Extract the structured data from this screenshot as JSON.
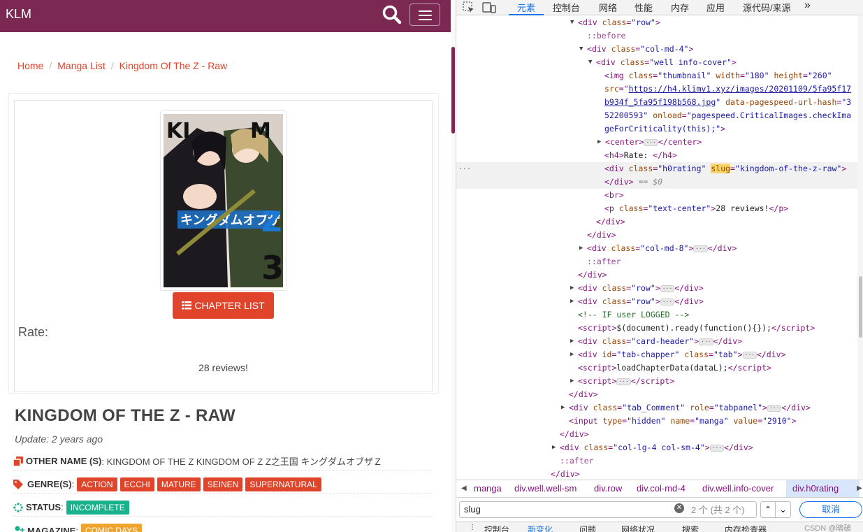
{
  "site": {
    "brand": "KLM",
    "breadcrumb": {
      "home": "Home",
      "list": "Manga List",
      "current": "Kingdom Of The Z - Raw",
      "sep": "/"
    },
    "chapter_button": "CHAPTER LIST",
    "rate_label": "Rate:",
    "reviews": "28 reviews!",
    "title": "KINGDOM OF THE Z - RAW",
    "update": "Update: 2 years ago",
    "other_name_label": "OTHER NAME (S)",
    "other_name_value": ": KINGDOM OF THE Z KINGDOM OF Z Z之王国 キングダムオブザＺ",
    "genre_label": "GENRE(S)",
    "genres": [
      "ACTION",
      "ECCHI",
      "MATURE",
      "SEINEN",
      "SUPERNATURAL"
    ],
    "status_label": "STATUS",
    "status_value": "INCOMPLETE",
    "magazine_label": "MAGAZINE",
    "magazine_value": "COMIC DAYS",
    "colon": ":",
    "accent_color": "#e0442b",
    "nav_color": "#7b2853"
  },
  "devtools": {
    "tabs": [
      "元素",
      "控制台",
      "网络",
      "性能",
      "内存",
      "应用",
      "源代码/来源"
    ],
    "more": "»",
    "code": {
      "l1_tag": "div",
      "l1_attr": "class",
      "l1_val": "\"row\"",
      "before": "::before",
      "l3_tag": "div",
      "l3_val": "\"col-md-4\"",
      "l4_tag": "div",
      "l4_val": "\"well info-cover\"",
      "img_tag": "img",
      "img_class": "\"thumbnail\"",
      "img_w_attr": "width",
      "img_w": "\"180\"",
      "img_h_attr": "height",
      "img_h": "\"260\"",
      "src_attr": "src",
      "src_1": "https://h4.klimv1.xyz/images/20201109/5fa95f17",
      "src_2": "b934f_5fa95f198b568.jpg",
      "hash_attr": "data-pagespeed-url-hash",
      "hash_1": "\"3",
      "hash_2": "52200593\"",
      "onload_attr": "onload",
      "onload_1": "\"pagespeed.CriticalImages.checkIma",
      "onload_2": "geForCriticality(this);\"",
      "center_tag": "center",
      "h4_text": "Rate: ",
      "rating_class": "\"h0rating\"",
      "slug_attr": "slug",
      "slug_val": "\"kingdom-of-the-z-raw\"",
      "eq0": "== $0",
      "br": "<br>",
      "p_class": "\"text-center\"",
      "p_text": "28 reviews!",
      "col8_val": "\"col-md-8\"",
      "after": "::after",
      "row_val": "\"row\"",
      "comment": "<!-- IF user LOGGED -->",
      "script1": "$(document).ready(function(){});",
      "card_val": "\"card-header\"",
      "tab_id": "\"tab-chapper\"",
      "tab_val": "\"tab\"",
      "script2": "loadChapterData(dataL);",
      "tabc_val": "\"tab_Comment\"",
      "role_attr": "role",
      "role_val": "\"tabpanel\"",
      "input_type": "\"hidden\"",
      "input_name": "\"manga\"",
      "input_value": "\"2910\"",
      "col_lg_val": "\"col-lg-4 col-sm-4\"",
      "ellipsis": "···"
    },
    "breadcrumbs": [
      "manga",
      "div.well.well-sm",
      "div.row",
      "div.col-md-4",
      "div.well.info-cover",
      "div.h0rating"
    ],
    "search_value": "slug",
    "match_count": "2 个 (共 2 个)",
    "cancel": "取消",
    "drawer_tabs": [
      "控制台",
      "新变化",
      "问题",
      "网络状况",
      "搜索",
      "内存检查器"
    ],
    "watermark": "CSDN @暗破"
  }
}
